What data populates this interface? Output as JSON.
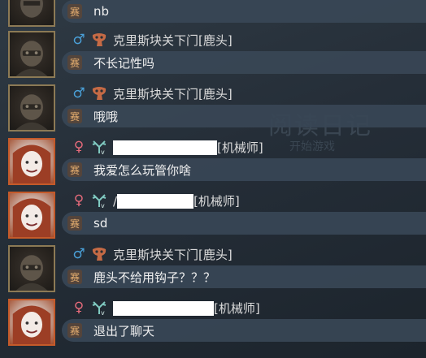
{
  "background_watermark": {
    "title": "阅读日记",
    "subtitle": "开始游戏"
  },
  "messages": [
    {
      "gender": "♂",
      "sai": "赛",
      "name_prefix": "",
      "name_suffix": "",
      "text": "nb",
      "role": "hunter"
    },
    {
      "gender": "♂",
      "sai": "赛",
      "name_prefix": "克里斯块关下门",
      "name_suffix": "[鹿头]",
      "text": "不长记性吗",
      "role": "hunter"
    },
    {
      "gender": "♂",
      "sai": "赛",
      "name_prefix": "克里斯块关下门",
      "name_suffix": "[鹿头]",
      "text": "哦哦",
      "role": "hunter"
    },
    {
      "gender": "♀",
      "sai": "赛",
      "name_prefix": "",
      "name_suffix": "[机械师]",
      "text": "我爱怎么玩管你啥",
      "role": "mech"
    },
    {
      "gender": "♀",
      "sai": "赛",
      "name_prefix": "/",
      "name_suffix": "[机械师]",
      "text": "sd",
      "role": "mech"
    },
    {
      "gender": "♂",
      "sai": "赛",
      "name_prefix": "克里斯块关下门",
      "name_suffix": "[鹿头]",
      "text": "鹿头不给用钩子？？？",
      "role": "hunter"
    },
    {
      "gender": "♀",
      "sai": "赛",
      "name_prefix": "",
      "name_suffix": "[机械师]",
      "text": "退出了聊天",
      "role": "mech"
    }
  ]
}
